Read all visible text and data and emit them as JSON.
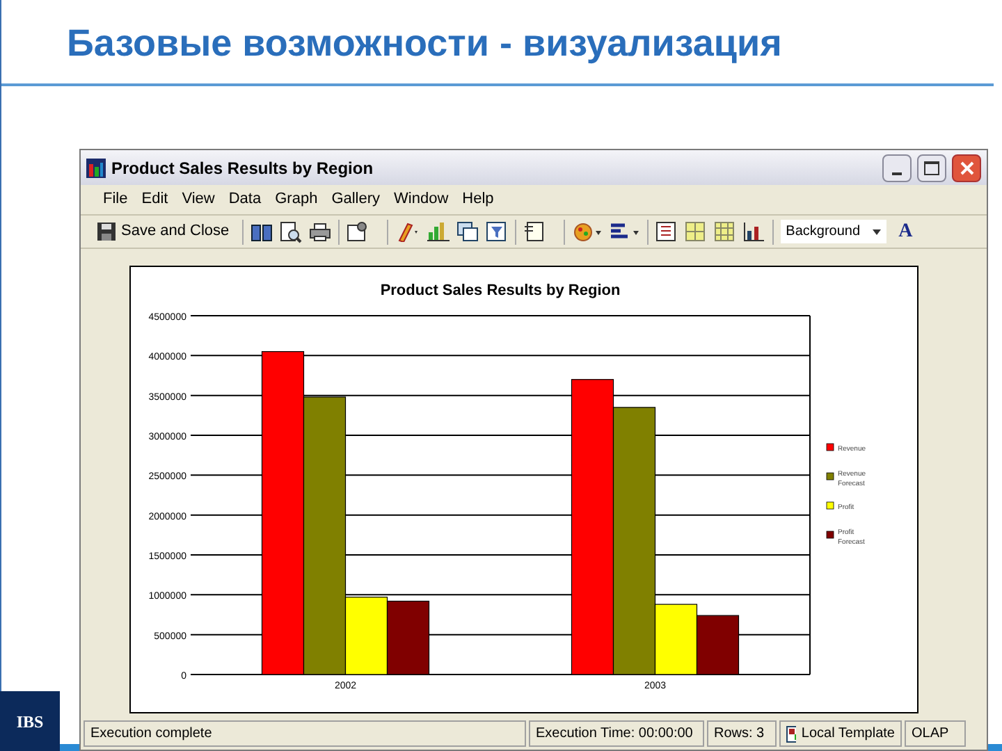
{
  "slide": {
    "title": "Базовые возможности - визуализация",
    "logo": "IBS"
  },
  "window": {
    "title": "Product Sales Results by Region"
  },
  "menu": [
    "File",
    "Edit",
    "View",
    "Data",
    "Graph",
    "Gallery",
    "Window",
    "Help"
  ],
  "toolbar": {
    "save_button": "Save and Close",
    "background_combo": "Background",
    "font_button": "A"
  },
  "chart": {
    "chart_data": {
      "type": "bar",
      "title": "Product Sales Results by Region",
      "categories": [
        "2002",
        "2003"
      ],
      "series": [
        {
          "name": "Revenue",
          "color": "#ff0000",
          "values": [
            4050000,
            3700000
          ]
        },
        {
          "name": "Revenue Forecast",
          "color": "#808000",
          "values": [
            3480000,
            3350000
          ]
        },
        {
          "name": "Profit",
          "color": "#ffff00",
          "values": [
            970000,
            880000
          ]
        },
        {
          "name": "Profit Forecast",
          "color": "#800000",
          "values": [
            920000,
            740000
          ]
        }
      ],
      "ylim": [
        0,
        4500000
      ],
      "grid": true,
      "legend": true,
      "yticks": [
        0,
        500000,
        1000000,
        1500000,
        2000000,
        2500000,
        3000000,
        3500000,
        4000000,
        4500000
      ]
    }
  },
  "status_bar": [
    "Execution complete",
    "Execution Time: 00:00:00",
    "Rows: 3",
    "Local Template",
    "OLAP"
  ]
}
